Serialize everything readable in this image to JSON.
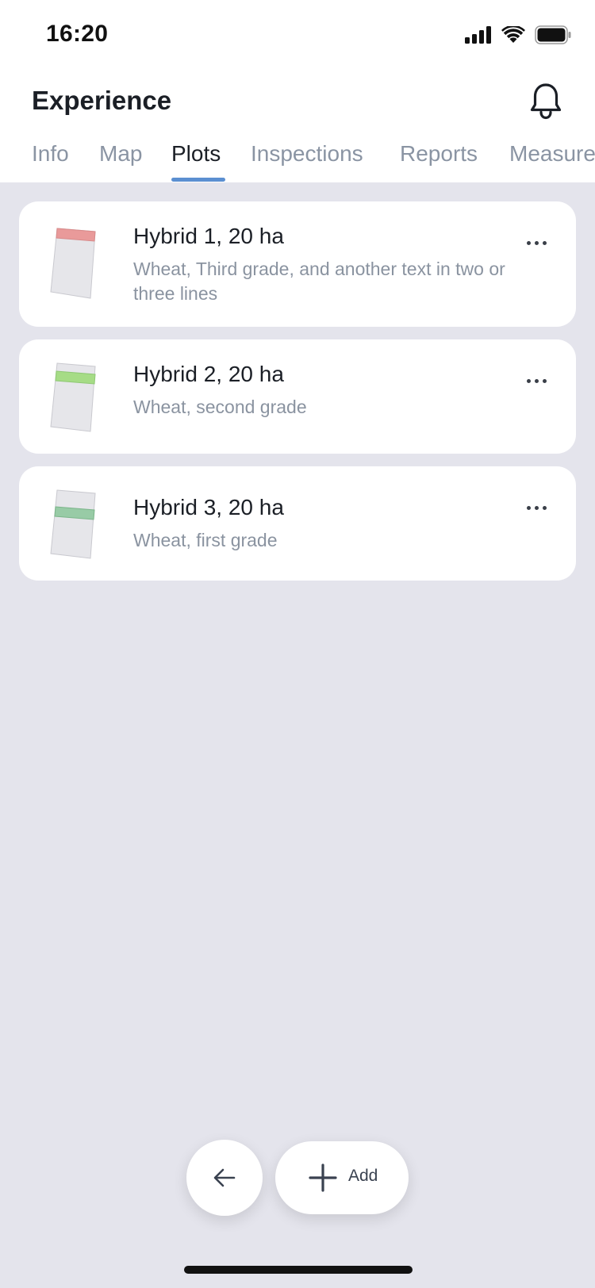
{
  "status_bar": {
    "time": "16:20"
  },
  "header": {
    "title": "Experience"
  },
  "tabs": [
    {
      "label": "Info",
      "active": false
    },
    {
      "label": "Map",
      "active": false
    },
    {
      "label": "Plots",
      "active": true
    },
    {
      "label": "Inspections",
      "active": false
    },
    {
      "label": "Reports",
      "active": false
    },
    {
      "label": "Measure",
      "active": false
    }
  ],
  "plots": [
    {
      "title": "Hybrid 1, 20 ha",
      "subtitle": "Wheat, Third grade, and another text in two or three lines",
      "band_color": "#e99a9a"
    },
    {
      "title": "Hybrid 2, 20 ha",
      "subtitle": "Wheat, second grade",
      "band_color": "#a6dc86"
    },
    {
      "title": "Hybrid 3, 20 ha",
      "subtitle": "Wheat, first grade",
      "band_color": "#98cba6"
    }
  ],
  "actions": {
    "add_label": "Add"
  },
  "colors": {
    "accent": "#5b8fd1",
    "background": "#e4e4ec",
    "card": "#ffffff",
    "muted_text": "#8a93a0"
  },
  "icons": {
    "notifications": "bell-icon",
    "more": "more-horizontal-icon",
    "back": "arrow-left-icon",
    "add": "plus-icon"
  }
}
